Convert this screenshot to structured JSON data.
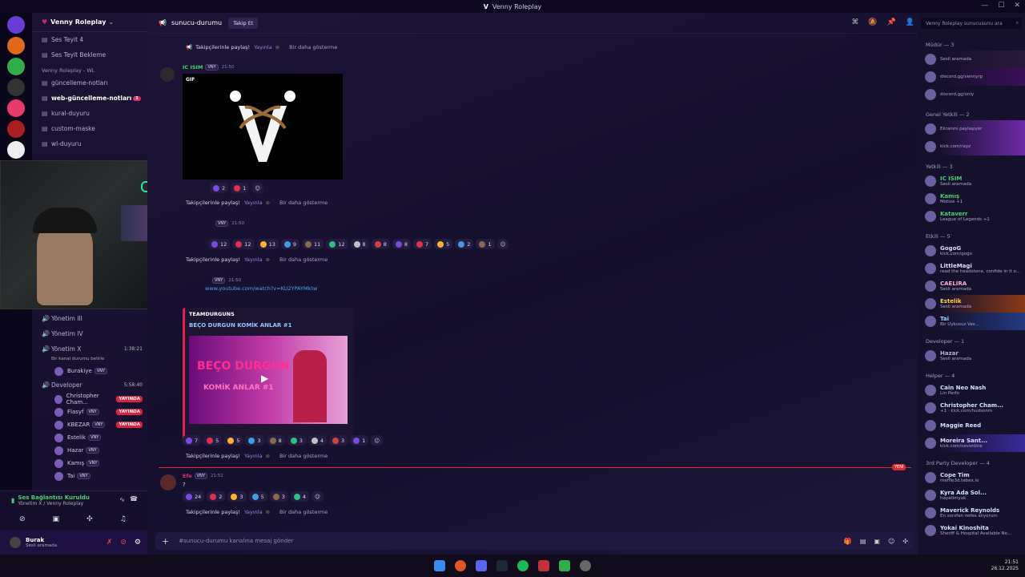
{
  "app": {
    "title": "Venny Roleplay"
  },
  "guild": {
    "name": "Venny Roleplay"
  },
  "channels_top": [
    {
      "label": "Ses Teyit 4",
      "bold": false
    },
    {
      "label": "Ses Teyit Bekleme",
      "bold": false
    }
  ],
  "category_wl": "Venny Roleplay - WL",
  "channels_wl": [
    {
      "label": "güncelleme-notları",
      "bold": false
    },
    {
      "label": "web-güncelleme-notları",
      "bold": true,
      "badge": "1"
    },
    {
      "label": "kural-duyuru",
      "bold": false
    },
    {
      "label": "custom-maske",
      "bold": false
    },
    {
      "label": "wl-duyuru",
      "bold": false
    }
  ],
  "voice": {
    "channels": [
      {
        "label": "Yönetim III"
      },
      {
        "label": "Yönetim IV"
      },
      {
        "label": "Yönetim X",
        "time": "1:38:21",
        "status": "Bir kanal durumu belirle"
      }
    ],
    "yonetim_x_users": [
      {
        "name": "Burakiye",
        "tag": "VNY"
      }
    ],
    "developer": {
      "label": "Developer",
      "time": "5:58:40"
    },
    "developer_users": [
      {
        "name": "Christopher Cham...",
        "live": "YAYINDA"
      },
      {
        "name": "Flasyf",
        "tag": "VNY",
        "live": "YAYINDA"
      },
      {
        "name": "KBEZAR",
        "tag": "VNY",
        "live": "YAYINDA"
      },
      {
        "name": "Estelik",
        "tag": "VNY"
      },
      {
        "name": "Hazar",
        "tag": "VNY"
      },
      {
        "name": "Kamış",
        "tag": "VNY"
      },
      {
        "name": "Tai",
        "tag": "VNY"
      }
    ]
  },
  "connection": {
    "title": "Ses Bağlantısı Kuruldu",
    "sub": "Yönetim X / Venny Roleplay"
  },
  "user": {
    "name": "Burak",
    "status": "Sesli aramada"
  },
  "header": {
    "channel": "sunucu-durumu",
    "follow": "Takip Et"
  },
  "share": {
    "label": "Takipçilerinle paylaş!",
    "link": "Yayınla",
    "never": "Bir daha gösterme"
  },
  "msg1": {
    "author": "IC ISIM",
    "tag": "VNY",
    "time": "21:50",
    "gif": "GIF"
  },
  "reacts1": [
    "2",
    "1"
  ],
  "msg2": {
    "tag": "VNY",
    "time": "21:50"
  },
  "reacts2": [
    "12",
    "12",
    "13",
    "9",
    "11",
    "12",
    "8",
    "8",
    "8",
    "7",
    "5",
    "2",
    "1"
  ],
  "msg3": {
    "tag": "VNY",
    "time": "21:50",
    "url": "www.youtube.com/watch?v=KU2YPAYMktw"
  },
  "embed": {
    "provider": "TEAMDURGUNS",
    "title": "BEÇO DURGUN KOMİK ANLAR #1",
    "thumb_title": "BEÇO DURGUN",
    "thumb_sub": "KOMİK ANLAR #1"
  },
  "reacts3": [
    "7",
    "5",
    "5",
    "3",
    "8",
    "3",
    "4",
    "3",
    "1"
  ],
  "new_label": "YENİ",
  "msg4": {
    "author": "Efe",
    "tag": "VNY",
    "time": "21:51",
    "text": "?"
  },
  "reacts4": [
    "24",
    "2",
    "3",
    "5",
    "3",
    "4"
  ],
  "composer": {
    "placeholder": "#sunucu-durumu kanalına mesaj gönder"
  },
  "members": {
    "search": "Venny Roleplay sunucusunu ara",
    "groups": [
      {
        "label": "Müdür — 3",
        "items": [
          {
            "name": "",
            "status": "Sesli aramada",
            "color": "#e0306a",
            "hl": "#2a1a3c"
          },
          {
            "name": "",
            "status": "discord.gg/vennyrp",
            "color": "#d455ff",
            "hl": "#3a1058"
          },
          {
            "name": "",
            "status": "discord.gg/only",
            "color": "#e31e52",
            "hl": ""
          }
        ]
      },
      {
        "label": "Genel Yetkili — 2",
        "items": [
          {
            "name": "",
            "status": "Ekranını paylaşıyor",
            "color": "#ff4d6a",
            "hl": "#6d2aa8"
          },
          {
            "name": "",
            "status": "kick.com/rayz",
            "color": "#ff4d6a",
            "hl": "#6d2aa8"
          }
        ]
      },
      {
        "label": "Yetkili — 3",
        "items": [
          {
            "name": "IC ISIM",
            "status": "Sesli aramada",
            "color": "#3fd46d",
            "hl": ""
          },
          {
            "name": "Kamış",
            "status": "Motive +1",
            "color": "#3fd46d",
            "hl": ""
          },
          {
            "name": "Kataverr",
            "status": "League of Legends +1",
            "color": "#3fd46d",
            "hl": ""
          }
        ]
      },
      {
        "label": "Etkili — 5",
        "items": [
          {
            "name": "GogoG",
            "status": "kick.com/gogo",
            "color": "#e0d7ff",
            "hl": ""
          },
          {
            "name": "LittleMagi",
            "status": "read the headstone, confide in it o...",
            "color": "#e0d7ff",
            "hl": ""
          },
          {
            "name": "CAELIRA",
            "status": "Sesli aramada",
            "color": "#ffb0d0",
            "hl": ""
          },
          {
            "name": "Estelik",
            "status": "Sesli aramada",
            "color": "#ffd54a",
            "hl": "#8a3a18"
          },
          {
            "name": "Tai",
            "status": "Bir Uykusuz Vas...",
            "color": "#9ad4ff",
            "hl": "#243a80"
          }
        ]
      },
      {
        "label": "Developer — 1",
        "items": [
          {
            "name": "Hazar",
            "status": "Sesli aramada",
            "color": "#b8b0d8",
            "hl": ""
          }
        ]
      },
      {
        "label": "Helper — 4",
        "items": [
          {
            "name": "Cain Neo Nash",
            "status": "Lin Perfo",
            "color": "#cfe2ff",
            "hl": ""
          },
          {
            "name": "Christopher Cham...",
            "status": "+1 · kick.com/hudsonm",
            "color": "#cfe2ff",
            "hl": ""
          },
          {
            "name": "Maggie Reed",
            "status": "",
            "color": "#cfe2ff",
            "hl": ""
          },
          {
            "name": "Moreira Sant...",
            "status": "kick.com/cevonline",
            "color": "#e0d7ff",
            "hl": "#3a2a9a"
          }
        ]
      },
      {
        "label": "3rd Party Developer — 4",
        "items": [
          {
            "name": "Cope Tim",
            "status": "meffle3d.tebex.io",
            "color": "#cfe2ff",
            "hl": ""
          },
          {
            "name": "Kyra Ada Sol...",
            "status": "hayatimyok",
            "color": "#cfe2ff",
            "hl": ""
          },
          {
            "name": "Maverick Reynolds",
            "status": "En sorsfan nefes alıyorum",
            "color": "#cfe2ff",
            "hl": ""
          },
          {
            "name": "Yokai Kinoshita",
            "status": "Sheriff & Hospital Available No...",
            "color": "#cfe2ff",
            "hl": ""
          }
        ]
      }
    ]
  },
  "clock": {
    "time": "21:51",
    "date": "26.12.2025"
  },
  "colors": {
    "accent": "#9a84e8",
    "live": "#d8243c",
    "embed_border": "#e31e52",
    "new": "#e02a2a"
  }
}
